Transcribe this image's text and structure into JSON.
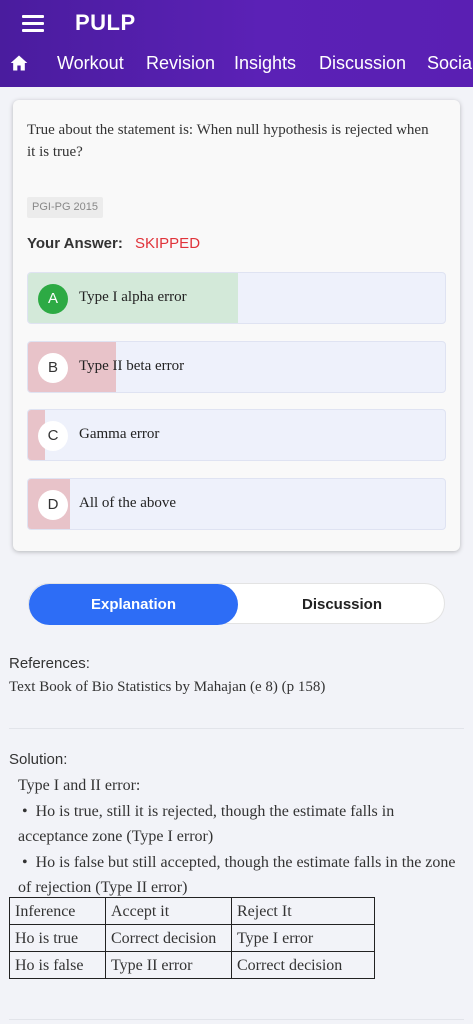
{
  "app": {
    "title": "PULP"
  },
  "nav": {
    "items": [
      "Workout",
      "Revision",
      "Insights",
      "Discussion",
      "Social"
    ]
  },
  "question": {
    "text": "True about the statement is: When null hypothesis is rejected when it is true?",
    "tag": "PGI-PG 2015",
    "your_answer_label": "Your Answer:",
    "your_answer_value": "SKIPPED",
    "options": [
      {
        "letter": "A",
        "text": "Type I alpha error",
        "percent": 50,
        "correct": true,
        "fill_color": "#d3e9d9"
      },
      {
        "letter": "B",
        "text": "Type II beta error",
        "percent": 21,
        "correct": false,
        "fill_color": "#e8c3c9"
      },
      {
        "letter": "C",
        "text": "Gamma error",
        "percent": 4,
        "correct": false,
        "fill_color": "#e8c3c9"
      },
      {
        "letter": "D",
        "text": "All of the above",
        "percent": 10,
        "correct": false,
        "fill_color": "#e8c3c9"
      }
    ]
  },
  "tabs": {
    "explanation": "Explanation",
    "discussion": "Discussion",
    "active": "explanation",
    "active_color": "#2d6df6"
  },
  "references": {
    "title": "References:",
    "text": "Text Book of Bio Statistics by Mahajan (e 8) (p 158)"
  },
  "solution": {
    "title": "Solution:",
    "intro": "Type I and II error:",
    "bullets": [
      "Ho is true, still it is rejected, though the estimate falls in acceptance zone (Type I error)",
      "Ho is false but still accepted, though the estimate falls in the zone of rejection (Type II error)"
    ],
    "table": [
      [
        "Inference",
        "Accept it",
        "Reject It"
      ],
      [
        "Ho is true",
        "Correct decision",
        "Type I error"
      ],
      [
        "Ho is false",
        "Type II error",
        "Correct decision"
      ]
    ]
  },
  "colors": {
    "header": "#5b21b6",
    "skipped": "#e0333a",
    "correct_badge": "#2daa44"
  }
}
